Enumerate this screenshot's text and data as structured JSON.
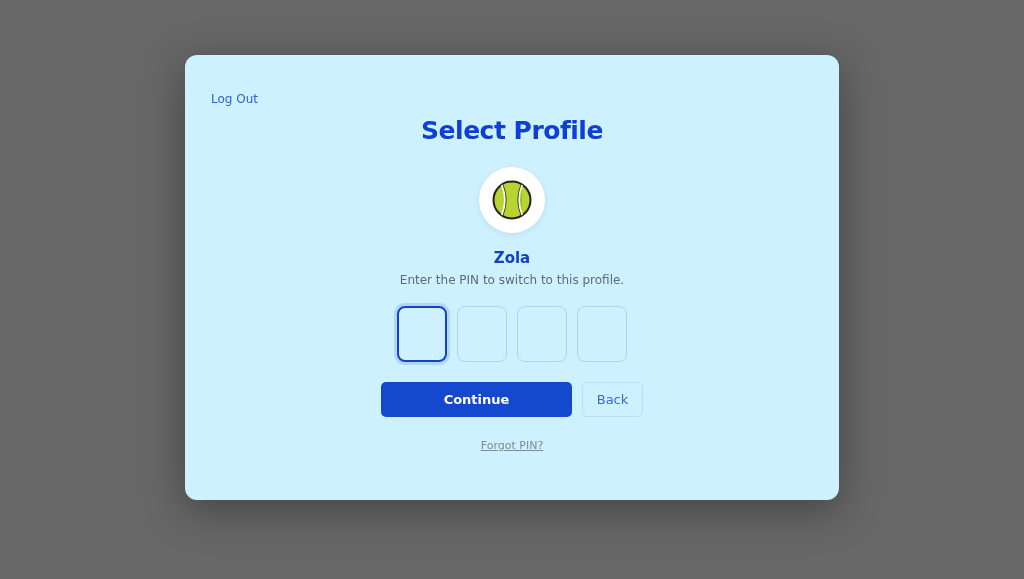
{
  "dialog": {
    "logout_link": "Log Out",
    "title": "Select Profile",
    "profile_name": "Zola",
    "instruction": "Enter the PIN to switch to this profile.",
    "pin_digits": [
      {
        "focused": true
      },
      {
        "focused": false
      },
      {
        "focused": false
      },
      {
        "focused": false
      }
    ],
    "buttons": [
      {
        "label": "Continue",
        "kind": "primary"
      },
      {
        "label": "Back",
        "kind": "secondary"
      }
    ],
    "forgot_link": "Forgot PIN?"
  }
}
